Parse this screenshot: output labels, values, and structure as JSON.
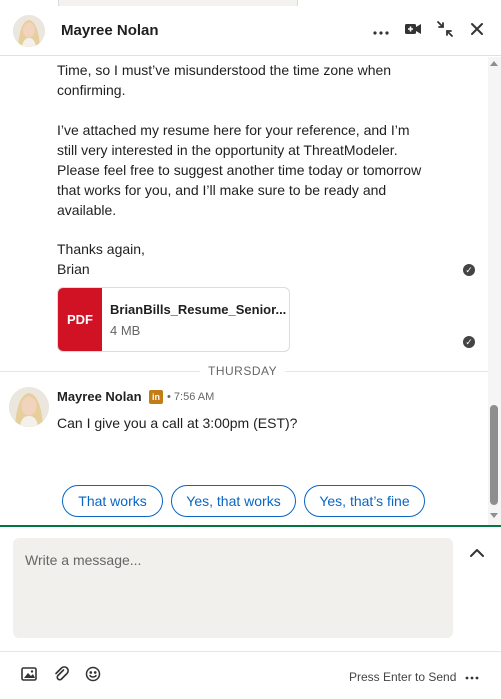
{
  "header": {
    "contact_name": "Mayree Nolan"
  },
  "conversation": {
    "previous_message_lines": [
      "Time, so I must’ve misunderstood the time zone when",
      "confirming.",
      "",
      "I’ve attached my resume here for your reference, and I’m",
      "still very interested in the opportunity at ThreatModeler.",
      "Please feel free to suggest another time today or tomorrow",
      "that works for you, and I’ll make sure to be ready and",
      "available.",
      "",
      "Thanks again,",
      "Brian"
    ],
    "attachment": {
      "type_label": "PDF",
      "file_name": "BrianBills_Resume_Senior...",
      "file_size": "4 MB"
    },
    "day_divider": "THURSDAY",
    "latest_message": {
      "sender": "Mayree Nolan",
      "badge": "in",
      "time": "• 7:56 AM",
      "text": "Can I give you a call at 3:00pm (EST)?"
    },
    "quick_replies": [
      "That works",
      "Yes, that works",
      "Yes, that’s fine"
    ]
  },
  "composer": {
    "placeholder": "Write a message..."
  },
  "footer": {
    "send_hint": "Press Enter to Send"
  },
  "icons": {
    "more": "more-horizontal-icon",
    "video": "video-call-icon",
    "collapse": "collapse-icon",
    "close": "close-icon",
    "read": "read-receipt-icon",
    "expand": "chevron-up-icon",
    "image": "image-icon",
    "attach": "paperclip-icon",
    "emoji": "emoji-icon"
  },
  "colors": {
    "accent": "#0a66c2",
    "pdf_red": "#d11124",
    "linkedin_badge": "#c37d16",
    "divider_green": "#057642"
  }
}
